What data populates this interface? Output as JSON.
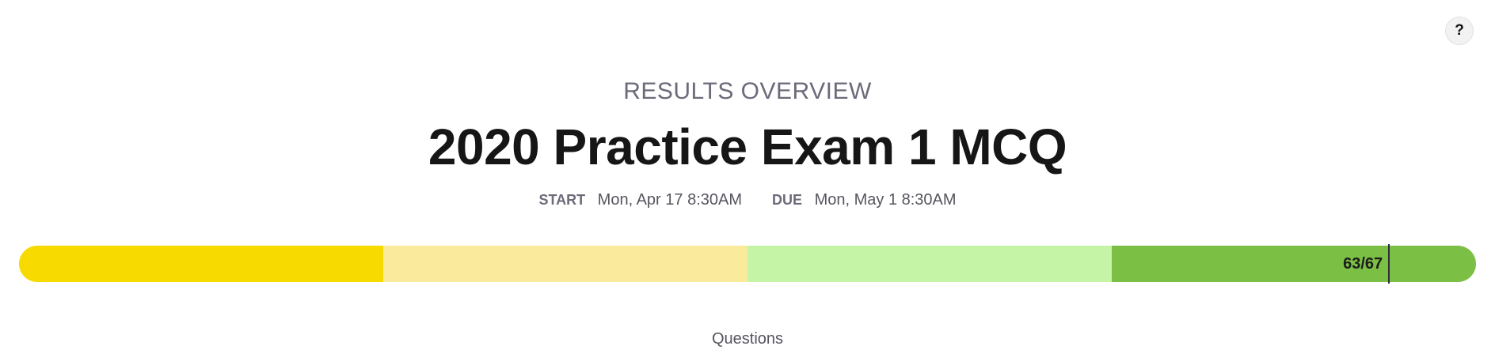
{
  "help": {
    "label": "?"
  },
  "header": {
    "overline": "RESULTS OVERVIEW",
    "title": "2020 Practice Exam 1 MCQ"
  },
  "dates": {
    "start_label": "START",
    "start_value": "Mon, Apr 17 8:30AM",
    "due_label": "DUE",
    "due_value": "Mon, May 1 8:30AM"
  },
  "score": {
    "text": "63/67",
    "correct": 63,
    "total": 67
  },
  "bands": {
    "colors": [
      "#f7da00",
      "#faea9c",
      "#c6f4a7",
      "#7bbf45"
    ]
  },
  "section": {
    "label": "Questions"
  }
}
